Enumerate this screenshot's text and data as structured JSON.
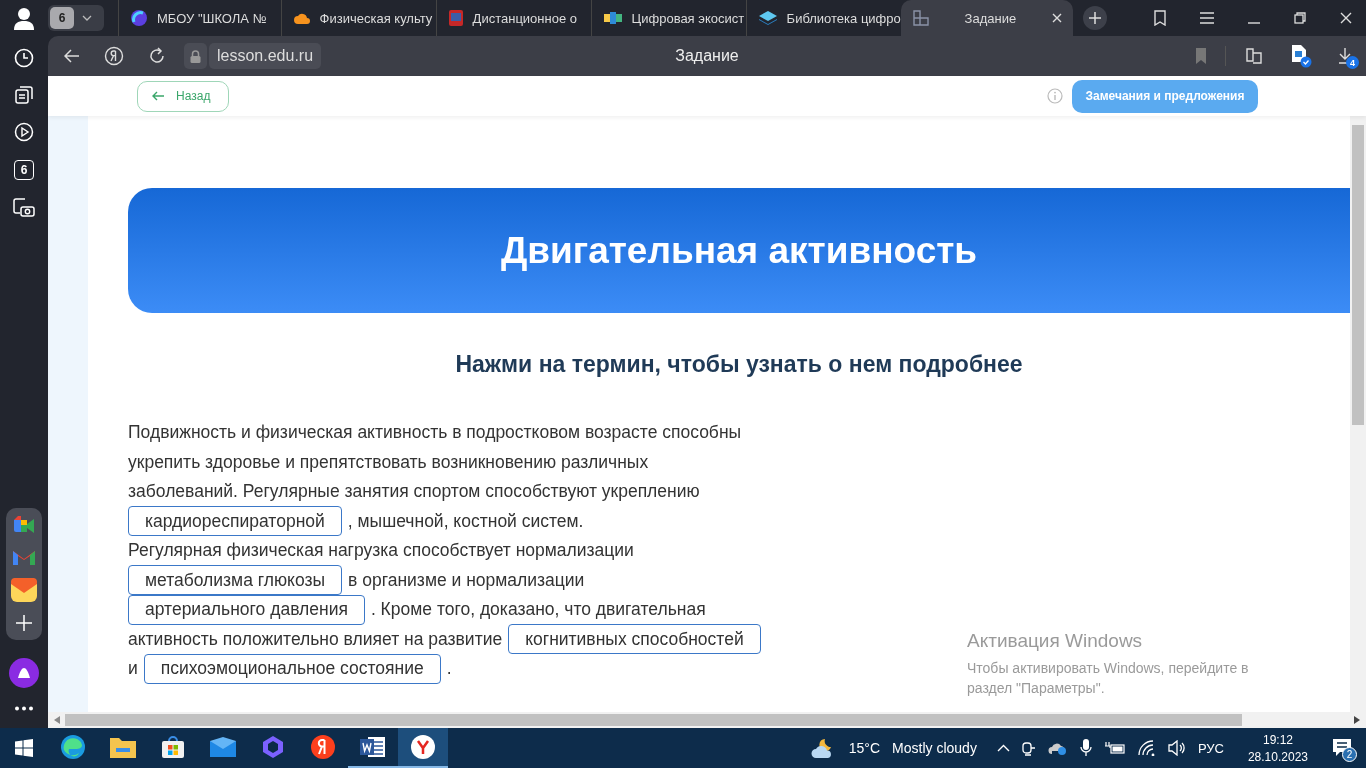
{
  "sidebar": {
    "counter": "6"
  },
  "tabs_bar": {
    "tab_count": "6",
    "tabs": [
      {
        "title": "МБОУ \"ШКОЛА №",
        "kind": "orb",
        "selected": false
      },
      {
        "title": "Физическая культу",
        "kind": "cloud",
        "selected": false
      },
      {
        "title": "Дистанционное о",
        "kind": "crest",
        "selected": false
      },
      {
        "title": "Цифровая экосист",
        "kind": "cubes",
        "selected": false
      },
      {
        "title": "Библиотека цифро",
        "kind": "stack",
        "selected": false
      },
      {
        "title": "Задание",
        "kind": "grid",
        "selected": true
      }
    ]
  },
  "address_bar": {
    "url": "lesson.edu.ru",
    "page_title": "Задание",
    "downloads_badge": "4"
  },
  "page": {
    "back_button": "Назад",
    "feedback_button": "Замечания и предложения",
    "banner_title": "Двигательная активность",
    "subtitle": "Нажми на термин, чтобы узнать о нем подробнее",
    "lines": [
      [
        {
          "kind": "text",
          "text": "Подвижность и физическая активность в подростковом возрасте способны"
        }
      ],
      [
        {
          "kind": "text",
          "text": "укрепить здоровье и препятствовать возникновению различных"
        }
      ],
      [
        {
          "kind": "text",
          "text": "заболеваний. Регулярные занятия спортом способствуют укреплению"
        }
      ],
      [
        {
          "kind": "term",
          "text": "кардиореспираторной"
        },
        {
          "kind": "text",
          "text": ", мышечной, костной систем."
        }
      ],
      [
        {
          "kind": "text",
          "text": "Регулярная физическая нагрузка способствует нормализации"
        }
      ],
      [
        {
          "kind": "term",
          "text": "метаболизма глюкозы"
        },
        {
          "kind": "text",
          "text": "в организме и нормализации"
        }
      ],
      [
        {
          "kind": "term",
          "text": "артериального давления"
        },
        {
          "kind": "text",
          "text": ". Кроме того, доказано, что двигательная"
        }
      ],
      [
        {
          "kind": "text",
          "text": "активность положительно влияет на развитие"
        },
        {
          "kind": "term",
          "text": "когнитивных способностей"
        }
      ],
      [
        {
          "kind": "text",
          "text": "и"
        },
        {
          "kind": "term",
          "text": "психоэмоциональное состояние"
        },
        {
          "kind": "text",
          "text": "."
        }
      ]
    ],
    "activation_notice": {
      "title": "Активация Windows",
      "text": "Чтобы активировать Windows, перейдите в раздел \"Параметры\"."
    }
  },
  "taskbar": {
    "apps": [
      {
        "kind": "edge",
        "running": false,
        "selected": false
      },
      {
        "kind": "folder",
        "running": false,
        "selected": false
      },
      {
        "kind": "store",
        "running": false,
        "selected": false
      },
      {
        "kind": "mail",
        "running": false,
        "selected": false
      },
      {
        "kind": "hexagon",
        "running": false,
        "selected": false
      },
      {
        "kind": "yandex",
        "running": false,
        "selected": false
      },
      {
        "kind": "word",
        "running": true,
        "selected": false
      },
      {
        "kind": "browser",
        "running": true,
        "selected": true
      }
    ],
    "temperature": "15°C",
    "weather": "Mostly cloudy",
    "language": "РУС",
    "time": "19:12",
    "date": "28.10.2023",
    "notifications": "2"
  }
}
